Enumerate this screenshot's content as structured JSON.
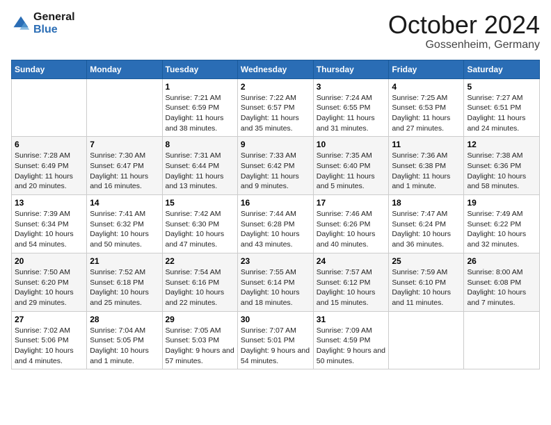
{
  "header": {
    "logo_line1": "General",
    "logo_line2": "Blue",
    "month": "October 2024",
    "location": "Gossenheim, Germany"
  },
  "weekdays": [
    "Sunday",
    "Monday",
    "Tuesday",
    "Wednesday",
    "Thursday",
    "Friday",
    "Saturday"
  ],
  "weeks": [
    [
      {
        "day": "",
        "sunrise": "",
        "sunset": "",
        "daylight": ""
      },
      {
        "day": "",
        "sunrise": "",
        "sunset": "",
        "daylight": ""
      },
      {
        "day": "1",
        "sunrise": "Sunrise: 7:21 AM",
        "sunset": "Sunset: 6:59 PM",
        "daylight": "Daylight: 11 hours and 38 minutes."
      },
      {
        "day": "2",
        "sunrise": "Sunrise: 7:22 AM",
        "sunset": "Sunset: 6:57 PM",
        "daylight": "Daylight: 11 hours and 35 minutes."
      },
      {
        "day": "3",
        "sunrise": "Sunrise: 7:24 AM",
        "sunset": "Sunset: 6:55 PM",
        "daylight": "Daylight: 11 hours and 31 minutes."
      },
      {
        "day": "4",
        "sunrise": "Sunrise: 7:25 AM",
        "sunset": "Sunset: 6:53 PM",
        "daylight": "Daylight: 11 hours and 27 minutes."
      },
      {
        "day": "5",
        "sunrise": "Sunrise: 7:27 AM",
        "sunset": "Sunset: 6:51 PM",
        "daylight": "Daylight: 11 hours and 24 minutes."
      }
    ],
    [
      {
        "day": "6",
        "sunrise": "Sunrise: 7:28 AM",
        "sunset": "Sunset: 6:49 PM",
        "daylight": "Daylight: 11 hours and 20 minutes."
      },
      {
        "day": "7",
        "sunrise": "Sunrise: 7:30 AM",
        "sunset": "Sunset: 6:47 PM",
        "daylight": "Daylight: 11 hours and 16 minutes."
      },
      {
        "day": "8",
        "sunrise": "Sunrise: 7:31 AM",
        "sunset": "Sunset: 6:44 PM",
        "daylight": "Daylight: 11 hours and 13 minutes."
      },
      {
        "day": "9",
        "sunrise": "Sunrise: 7:33 AM",
        "sunset": "Sunset: 6:42 PM",
        "daylight": "Daylight: 11 hours and 9 minutes."
      },
      {
        "day": "10",
        "sunrise": "Sunrise: 7:35 AM",
        "sunset": "Sunset: 6:40 PM",
        "daylight": "Daylight: 11 hours and 5 minutes."
      },
      {
        "day": "11",
        "sunrise": "Sunrise: 7:36 AM",
        "sunset": "Sunset: 6:38 PM",
        "daylight": "Daylight: 11 hours and 1 minute."
      },
      {
        "day": "12",
        "sunrise": "Sunrise: 7:38 AM",
        "sunset": "Sunset: 6:36 PM",
        "daylight": "Daylight: 10 hours and 58 minutes."
      }
    ],
    [
      {
        "day": "13",
        "sunrise": "Sunrise: 7:39 AM",
        "sunset": "Sunset: 6:34 PM",
        "daylight": "Daylight: 10 hours and 54 minutes."
      },
      {
        "day": "14",
        "sunrise": "Sunrise: 7:41 AM",
        "sunset": "Sunset: 6:32 PM",
        "daylight": "Daylight: 10 hours and 50 minutes."
      },
      {
        "day": "15",
        "sunrise": "Sunrise: 7:42 AM",
        "sunset": "Sunset: 6:30 PM",
        "daylight": "Daylight: 10 hours and 47 minutes."
      },
      {
        "day": "16",
        "sunrise": "Sunrise: 7:44 AM",
        "sunset": "Sunset: 6:28 PM",
        "daylight": "Daylight: 10 hours and 43 minutes."
      },
      {
        "day": "17",
        "sunrise": "Sunrise: 7:46 AM",
        "sunset": "Sunset: 6:26 PM",
        "daylight": "Daylight: 10 hours and 40 minutes."
      },
      {
        "day": "18",
        "sunrise": "Sunrise: 7:47 AM",
        "sunset": "Sunset: 6:24 PM",
        "daylight": "Daylight: 10 hours and 36 minutes."
      },
      {
        "day": "19",
        "sunrise": "Sunrise: 7:49 AM",
        "sunset": "Sunset: 6:22 PM",
        "daylight": "Daylight: 10 hours and 32 minutes."
      }
    ],
    [
      {
        "day": "20",
        "sunrise": "Sunrise: 7:50 AM",
        "sunset": "Sunset: 6:20 PM",
        "daylight": "Daylight: 10 hours and 29 minutes."
      },
      {
        "day": "21",
        "sunrise": "Sunrise: 7:52 AM",
        "sunset": "Sunset: 6:18 PM",
        "daylight": "Daylight: 10 hours and 25 minutes."
      },
      {
        "day": "22",
        "sunrise": "Sunrise: 7:54 AM",
        "sunset": "Sunset: 6:16 PM",
        "daylight": "Daylight: 10 hours and 22 minutes."
      },
      {
        "day": "23",
        "sunrise": "Sunrise: 7:55 AM",
        "sunset": "Sunset: 6:14 PM",
        "daylight": "Daylight: 10 hours and 18 minutes."
      },
      {
        "day": "24",
        "sunrise": "Sunrise: 7:57 AM",
        "sunset": "Sunset: 6:12 PM",
        "daylight": "Daylight: 10 hours and 15 minutes."
      },
      {
        "day": "25",
        "sunrise": "Sunrise: 7:59 AM",
        "sunset": "Sunset: 6:10 PM",
        "daylight": "Daylight: 10 hours and 11 minutes."
      },
      {
        "day": "26",
        "sunrise": "Sunrise: 8:00 AM",
        "sunset": "Sunset: 6:08 PM",
        "daylight": "Daylight: 10 hours and 7 minutes."
      }
    ],
    [
      {
        "day": "27",
        "sunrise": "Sunrise: 7:02 AM",
        "sunset": "Sunset: 5:06 PM",
        "daylight": "Daylight: 10 hours and 4 minutes."
      },
      {
        "day": "28",
        "sunrise": "Sunrise: 7:04 AM",
        "sunset": "Sunset: 5:05 PM",
        "daylight": "Daylight: 10 hours and 1 minute."
      },
      {
        "day": "29",
        "sunrise": "Sunrise: 7:05 AM",
        "sunset": "Sunset: 5:03 PM",
        "daylight": "Daylight: 9 hours and 57 minutes."
      },
      {
        "day": "30",
        "sunrise": "Sunrise: 7:07 AM",
        "sunset": "Sunset: 5:01 PM",
        "daylight": "Daylight: 9 hours and 54 minutes."
      },
      {
        "day": "31",
        "sunrise": "Sunrise: 7:09 AM",
        "sunset": "Sunset: 4:59 PM",
        "daylight": "Daylight: 9 hours and 50 minutes."
      },
      {
        "day": "",
        "sunrise": "",
        "sunset": "",
        "daylight": ""
      },
      {
        "day": "",
        "sunrise": "",
        "sunset": "",
        "daylight": ""
      }
    ]
  ]
}
